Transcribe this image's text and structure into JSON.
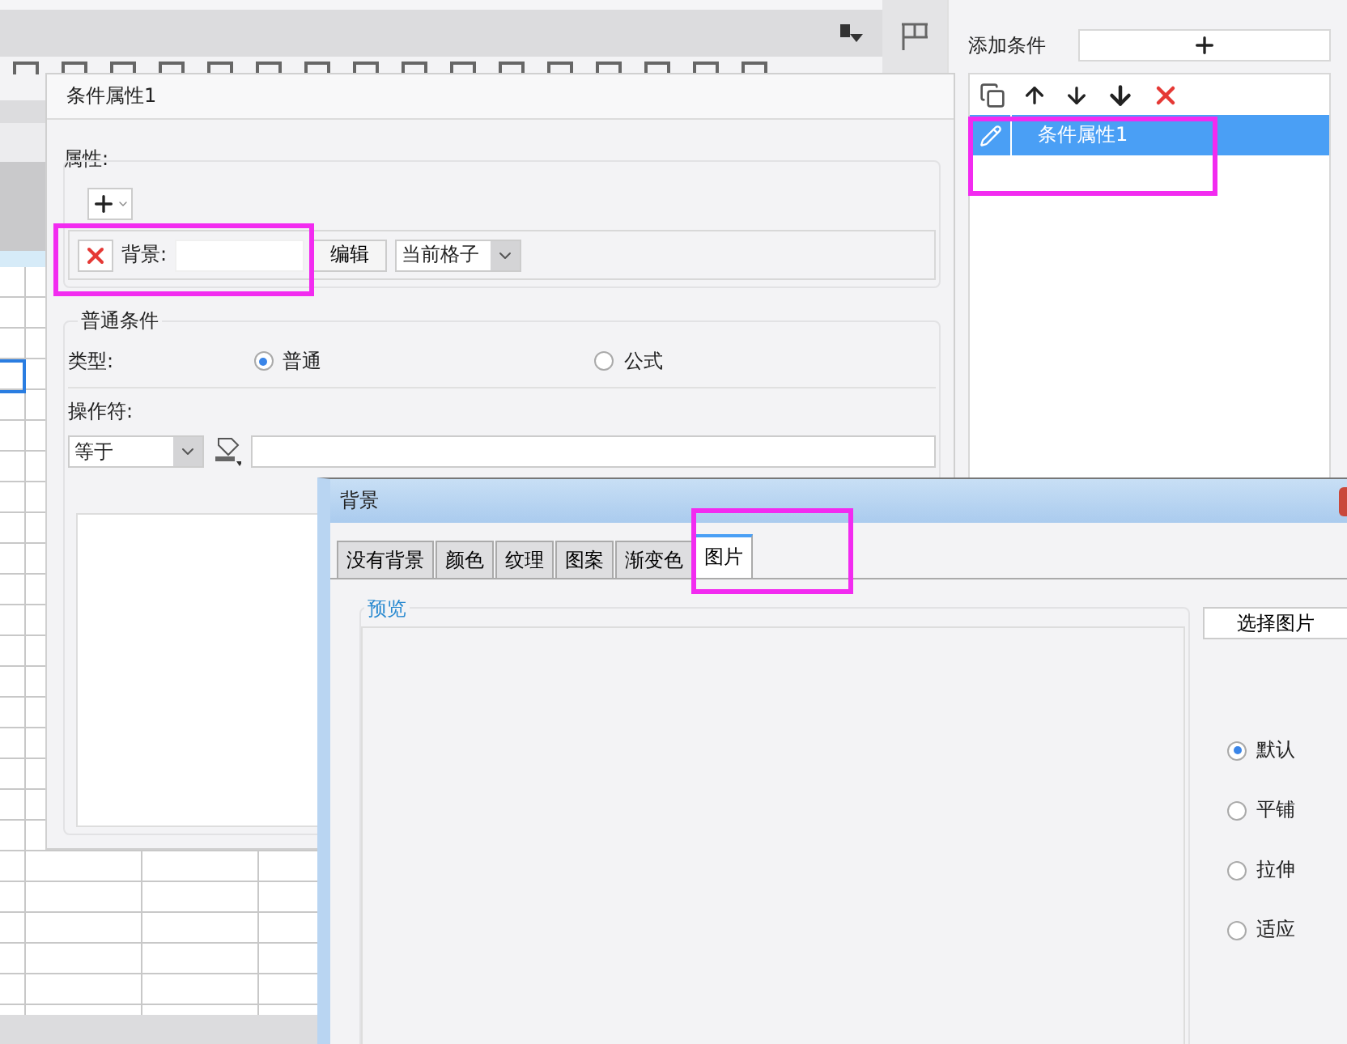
{
  "right_panel": {
    "add_label": "添加条件",
    "list_items": [
      {
        "label": "条件属性1",
        "selected": true
      }
    ]
  },
  "condition_dialog": {
    "title": "条件属性1",
    "properties_label": "属性:",
    "property_row": {
      "label": "背景:",
      "edit_button": "编辑",
      "scope": "当前格子"
    },
    "general": {
      "title": "普通条件",
      "type_label": "类型:",
      "types": [
        {
          "label": "普通",
          "selected": true
        },
        {
          "label": "公式",
          "selected": false
        }
      ],
      "operator_label": "操作符:",
      "operator": "等于"
    }
  },
  "background_dialog": {
    "title": "背景",
    "tabs": [
      {
        "label": "没有背景",
        "selected": false
      },
      {
        "label": "颜色",
        "selected": false
      },
      {
        "label": "纹理",
        "selected": false
      },
      {
        "label": "图案",
        "selected": false
      },
      {
        "label": "渐变色",
        "selected": false
      },
      {
        "label": "图片",
        "selected": true
      }
    ],
    "preview_label": "预览",
    "select_button": "选择图片",
    "modes": [
      {
        "label": "默认",
        "selected": true
      },
      {
        "label": "平铺",
        "selected": false
      },
      {
        "label": "拉伸",
        "selected": false
      },
      {
        "label": "适应",
        "selected": false
      }
    ]
  }
}
